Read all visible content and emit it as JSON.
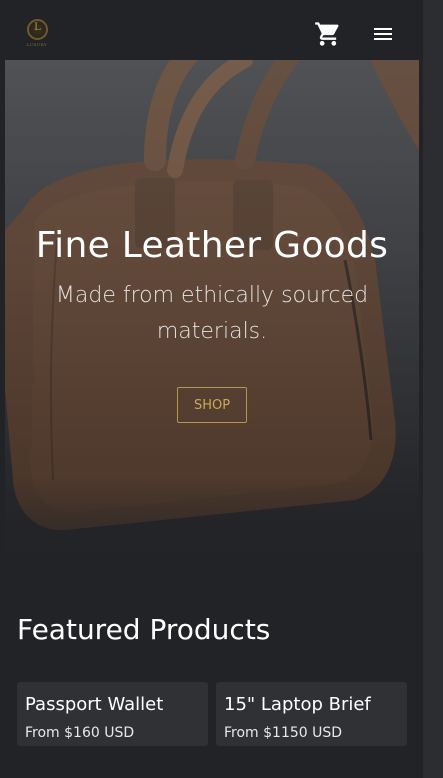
{
  "header": {
    "logo_text": "LUXURY",
    "logo_mark": "L",
    "cart_icon": "shopping-cart-icon",
    "menu_icon": "hamburger-menu-icon"
  },
  "hero": {
    "title": "Fine Leather Goods",
    "subtitle": "Made from ethically sourced materials.",
    "cta_label": "SHOP"
  },
  "featured": {
    "title": "Featured Products",
    "products": [
      {
        "name": "Passport Wallet",
        "price": "From $160 USD"
      },
      {
        "name": "15\" Laptop Brief",
        "price": "From $1150 USD"
      }
    ]
  },
  "colors": {
    "background": "#222326",
    "accent_gold": "#c9a95a",
    "card": "#303134",
    "leather": "#8a5431"
  }
}
